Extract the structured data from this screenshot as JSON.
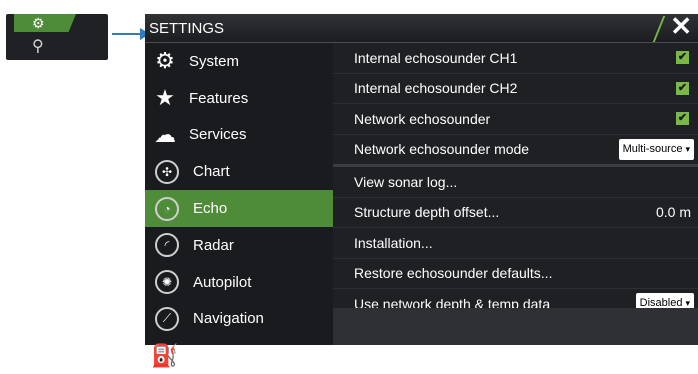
{
  "thumbnail": {
    "gear_icon": "gear-icon",
    "fork_icon": "transducer-icon"
  },
  "header": {
    "title": "SETTINGS",
    "close_icon": "close-icon"
  },
  "sidebar": {
    "items": [
      {
        "label": "System",
        "icon": "gear-icon"
      },
      {
        "label": "Features",
        "icon": "star-icon"
      },
      {
        "label": "Services",
        "icon": "cloud-icon"
      },
      {
        "label": "Chart",
        "icon": "globe-icon"
      },
      {
        "label": "Echo",
        "icon": "echo-icon",
        "active": true
      },
      {
        "label": "Radar",
        "icon": "radar-icon"
      },
      {
        "label": "Autopilot",
        "icon": "autopilot-icon"
      },
      {
        "label": "Navigation",
        "icon": "navigation-icon"
      },
      {
        "label": "Fuel",
        "icon": "fuel-icon"
      }
    ]
  },
  "settings": {
    "rows": [
      {
        "label": "Internal echosounder CH1",
        "checked": true
      },
      {
        "label": "Internal echosounder CH2",
        "checked": true
      },
      {
        "label": "Network echosounder",
        "checked": true
      },
      {
        "label": "Network echosounder mode",
        "dropdown": "Multi-source"
      },
      {
        "label": "View sonar log..."
      },
      {
        "label": "Structure depth offset...",
        "value": "0.0 m"
      },
      {
        "label": "Installation..."
      },
      {
        "label": "Restore echosounder defaults..."
      },
      {
        "label": "Use network depth & temp data",
        "dropdown": "Disabled"
      }
    ]
  },
  "colors": {
    "accent": "#4f8c3a",
    "check": "#7ab648",
    "panel": "#1f2023",
    "arrow": "#2f7dc0"
  }
}
